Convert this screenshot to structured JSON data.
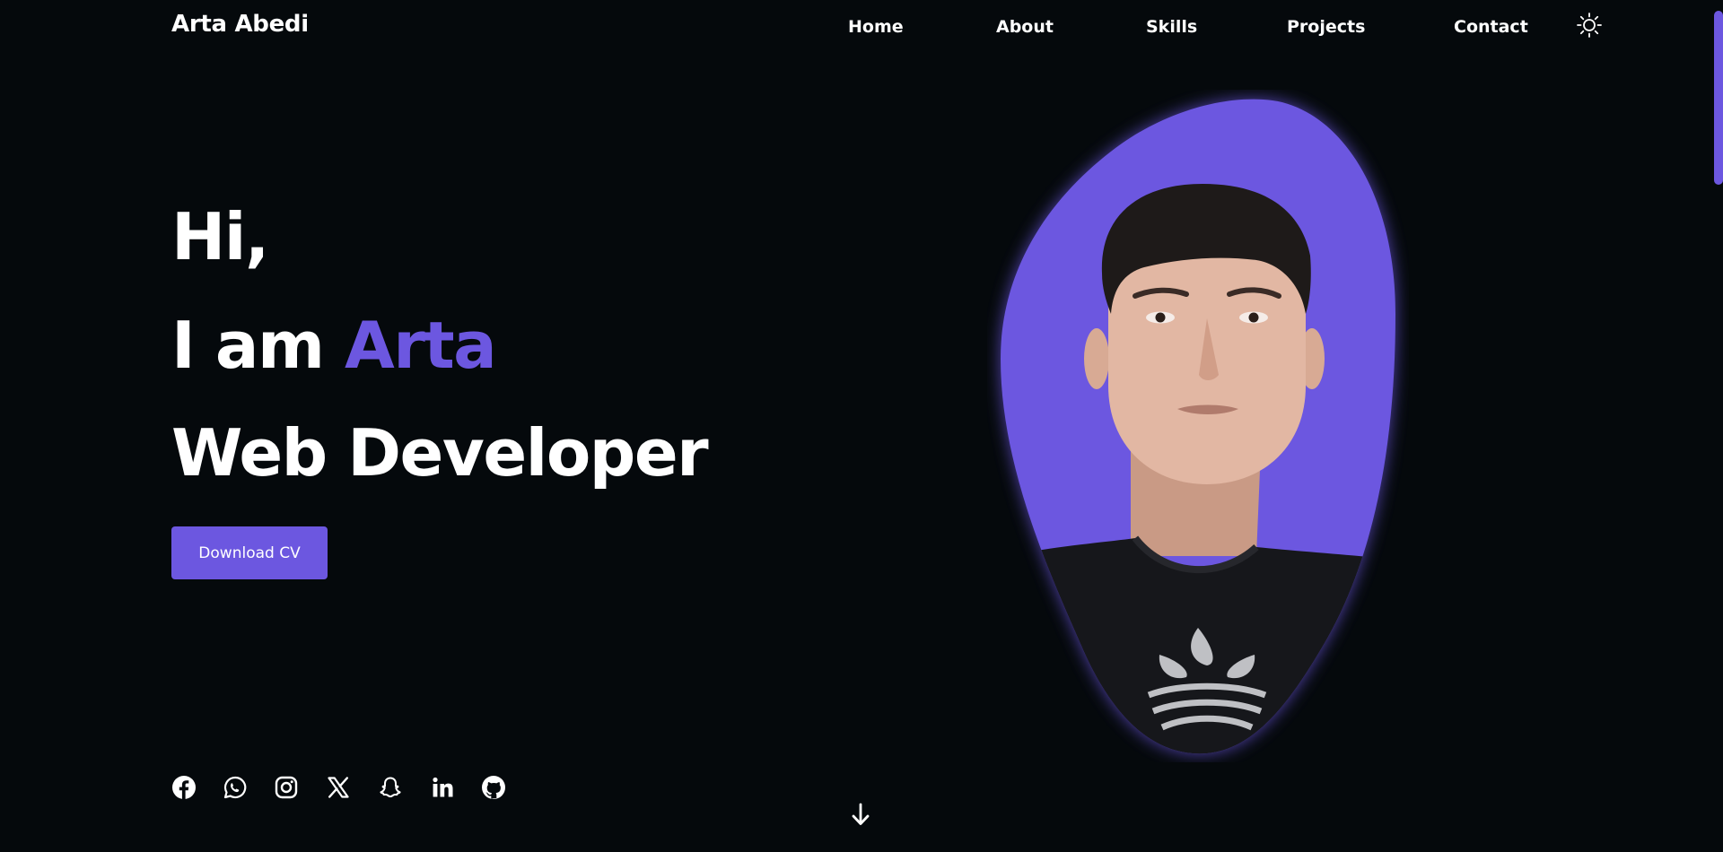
{
  "header": {
    "logo": "Arta Abedi",
    "nav": {
      "home": "Home",
      "about": "About",
      "skills": "Skills",
      "projects": "Projects",
      "contact": "Contact"
    },
    "theme_toggle_icon": "sun-icon"
  },
  "hero": {
    "line1": "Hi,",
    "line2_prefix": "I am ",
    "line2_name": "Arta",
    "line3": "Web Developer",
    "download_label": "Download CV"
  },
  "socials": [
    {
      "icon": "facebook-icon"
    },
    {
      "icon": "whatsapp-icon"
    },
    {
      "icon": "instagram-icon"
    },
    {
      "icon": "x-twitter-icon"
    },
    {
      "icon": "snapchat-icon"
    },
    {
      "icon": "linkedin-icon"
    },
    {
      "icon": "github-icon"
    }
  ],
  "scroll_down_icon": "arrow-down-icon",
  "portrait": {
    "image": "profile-photo",
    "blob_color": "#6c57e0"
  },
  "colors": {
    "background": "#05090c",
    "accent": "#6c57e0",
    "text": "#ffffff"
  }
}
